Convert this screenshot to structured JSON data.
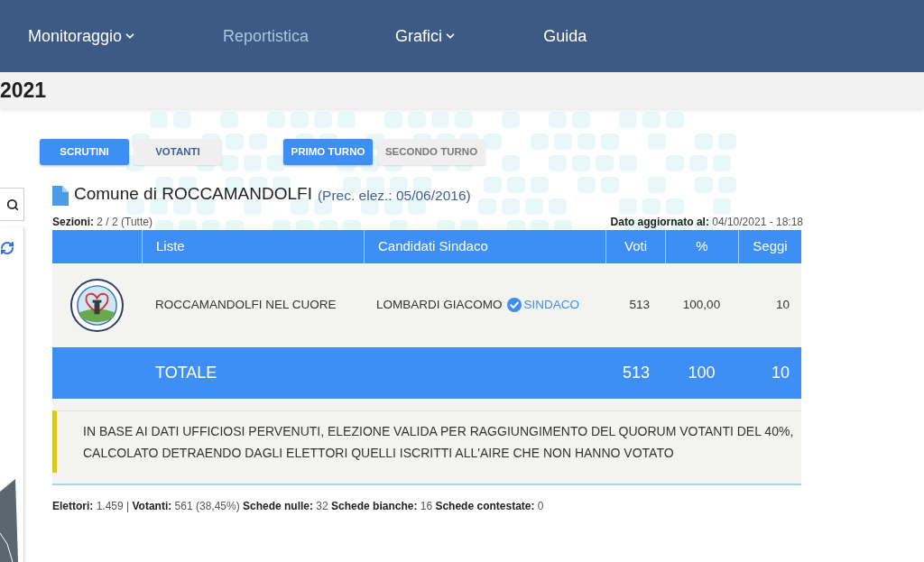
{
  "nav": {
    "items": [
      {
        "label": "Monitoraggio",
        "has_menu": true,
        "selected": false
      },
      {
        "label": "Reportistica",
        "has_menu": false,
        "selected": true
      },
      {
        "label": "Grafici",
        "has_menu": true,
        "selected": false
      },
      {
        "label": "Guida",
        "has_menu": false,
        "selected": false
      }
    ]
  },
  "page_title": "2021",
  "view_toggle": [
    {
      "label": "SCRUTINI",
      "selected": true,
      "disabled": false
    },
    {
      "label": "VOTANTI",
      "selected": false,
      "disabled": false
    }
  ],
  "round_toggle": [
    {
      "label": "PRIMO TURNO",
      "selected": true,
      "disabled": false
    },
    {
      "label": "SECONDO TURNO",
      "selected": false,
      "disabled": true
    }
  ],
  "heading": {
    "title": "Comune di ROCCAMANDOLFI",
    "subtitle": "(Prec. elez.: 05/06/2016)"
  },
  "sections": "**Sezioni:** 2 / 2 (Tutte)",
  "updated": "**Dato aggiornato al:** 04/10/2021 - 18:18",
  "table": {
    "columns": [
      "Liste",
      "Candidati Sindaco",
      "Voti",
      "%",
      "Seggi"
    ],
    "rows": [
      {
        "list": "ROCCAMANDOLFI NEL CUORE",
        "candidate": "LOMBARDI GIACOMO",
        "elected": true,
        "badge": "SINDACO",
        "votes": "513",
        "percent": "100,00",
        "seats": "10"
      }
    ],
    "total": {
      "label": "TOTALE",
      "votes": "513",
      "percent": "100",
      "seats": "10"
    }
  },
  "notice": "IN BASE AI DATI UFFICIOSI PERVENUTI, ELEZIONE VALIDA PER RAGGIUNGIMENTO DEL QUORUM VOTANTI DEL 40%, CALCOLATO DETRAENDO DAGLI ELETTORI QUELLI ISCRITTI ALL'AIRE CHE NON HANNO VOTATO",
  "stats": "**Elettori:** 1.459 | **Votanti:** 561 (38,45%) **Schede nulle:** 32 **Schede bianche:** 16 **Schede contestate:** 0"
}
